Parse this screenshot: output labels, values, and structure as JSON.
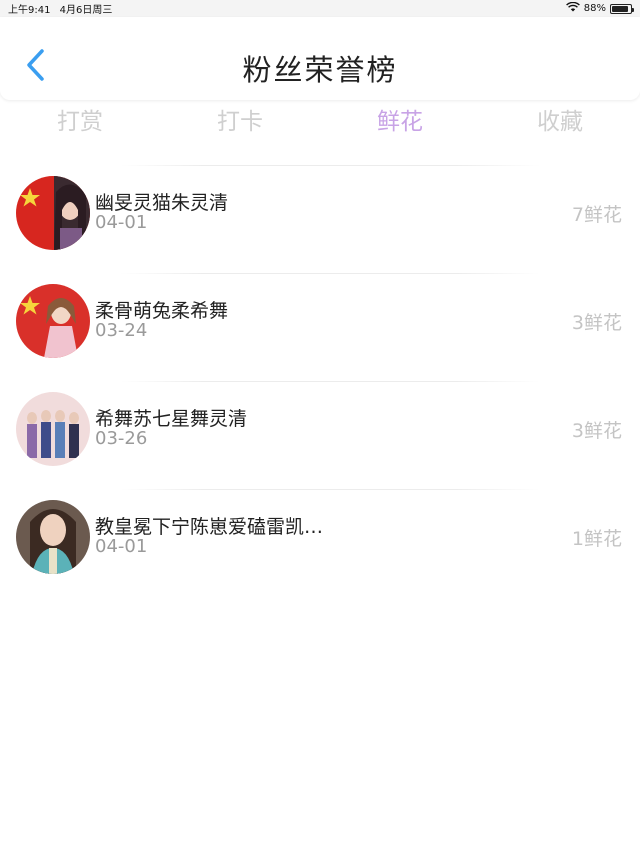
{
  "status_bar": {
    "time": "上午9:41",
    "date": "4月6日周三",
    "battery_pct": "88%",
    "battery_level": 0.88
  },
  "header": {
    "title": "粉丝荣誉榜"
  },
  "tabs": [
    {
      "label": "打赏",
      "active": false
    },
    {
      "label": "打卡",
      "active": false
    },
    {
      "label": "鲜花",
      "active": true
    },
    {
      "label": "收藏",
      "active": false
    }
  ],
  "entries": [
    {
      "name": "幽旻灵猫朱灵清",
      "date": "04-01",
      "count": "7鲜花"
    },
    {
      "name": "柔骨萌兔柔希舞",
      "date": "03-24",
      "count": "3鲜花"
    },
    {
      "name": "希舞苏七星舞灵清",
      "date": "03-26",
      "count": "3鲜花"
    },
    {
      "name": "教皇冕下宁陈崽爱磕雷凯…",
      "date": "04-01",
      "count": "1鲜花"
    }
  ],
  "colors": {
    "accent_tab": "#c8a3e6",
    "back_icon": "#3a9ef0",
    "inactive_tab": "#cfcfcf"
  }
}
